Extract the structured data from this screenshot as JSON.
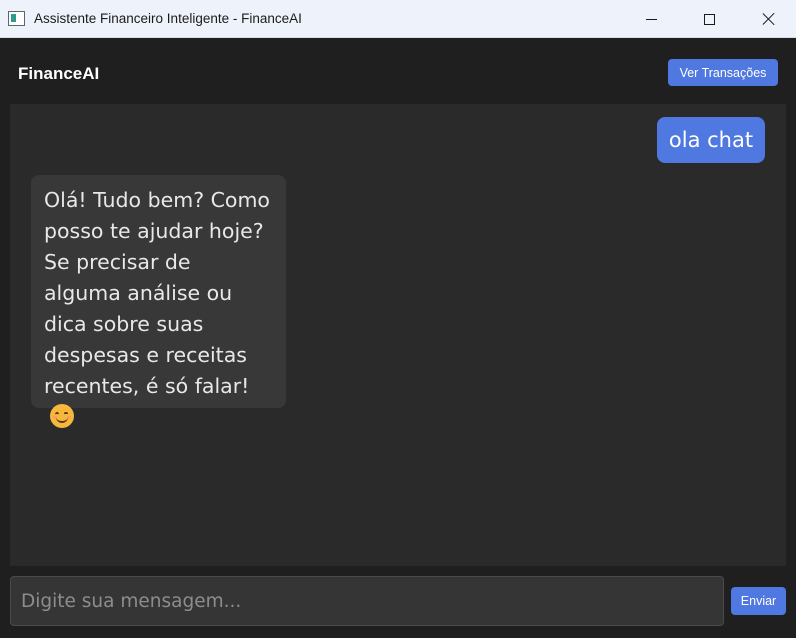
{
  "window": {
    "title": "Assistente Financeiro Inteligente - FinanceAI",
    "icon": "app-window-icon"
  },
  "header": {
    "brand": "FinanceAI",
    "transactions_button": "Ver Transações"
  },
  "chat": {
    "messages": [
      {
        "role": "user",
        "text": "ola chat"
      },
      {
        "role": "assistant",
        "text": "Olá! Tudo bem? Como posso te ajudar hoje? Se precisar de alguma análise ou dica sobre suas despesas e receitas recentes, é só falar!",
        "emoji": "smiling-face-emoji"
      }
    ]
  },
  "input": {
    "placeholder": "Digite sua mensagem...",
    "value": "",
    "send_label": "Enviar"
  },
  "colors": {
    "accent": "#4f78e0",
    "background": "#1f1f1f",
    "chat_background": "#2a2a2a",
    "assistant_bubble": "#383838"
  }
}
